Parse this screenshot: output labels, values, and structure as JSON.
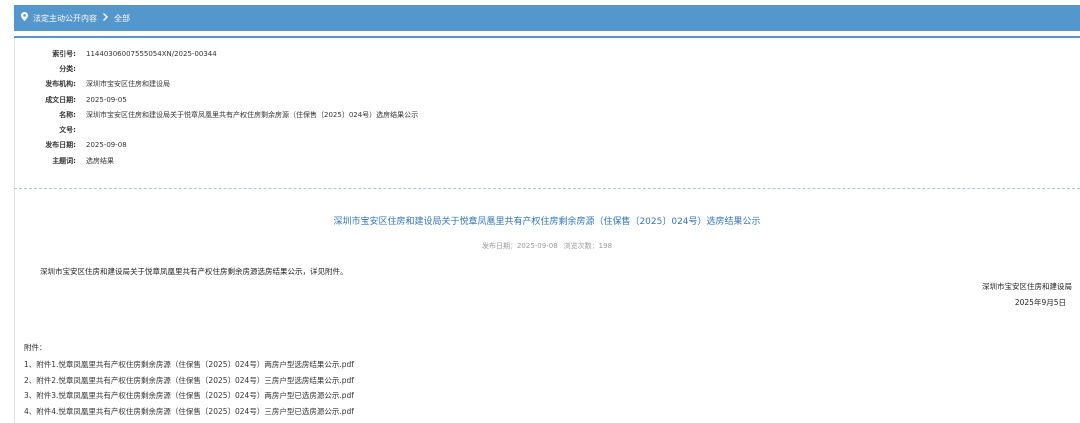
{
  "breadcrumb": {
    "icon": "map-pin-icon",
    "items": [
      "法定主动公开内容",
      "全部"
    ],
    "separator_icon": "chevron-right-icon",
    "bar_color": "#5497cc"
  },
  "meta": {
    "rows": [
      {
        "key": "索引号:",
        "value": "11440306007555054XN/2025-00344"
      },
      {
        "key": "分类:",
        "value": ""
      },
      {
        "key": "发布机构:",
        "value": "深圳市宝安区住房和建设局"
      },
      {
        "key": "成文日期:",
        "value": "2025-09-05"
      },
      {
        "key": "名称:",
        "value": "深圳市宝安区住房和建设局关于悦章凤凰里共有产权住房剩余房源（住保售〔2025〕024号）选房结果公示"
      },
      {
        "key": "文号:",
        "value": ""
      },
      {
        "key": "发布日期:",
        "value": "2025-09-08"
      },
      {
        "key": "主题词:",
        "value": "选房结果"
      }
    ]
  },
  "article": {
    "title": "深圳市宝安区住房和建设局关于悦章凤凰里共有产权住房剩余房源（住保售〔2025〕024号）选房结果公示",
    "publish_label": "发布日期：2025-09-08",
    "views_label": "浏览次数：198",
    "title_color": "#3275b8",
    "body": "深圳市宝安区住房和建设局关于悦章凤凰里共有产权住房剩余房源选房结果公示，详见附件。",
    "sign_org": "深圳市宝安区住房和建设局",
    "sign_date": "2025年9月5日"
  },
  "attachments": {
    "heading": "附件：",
    "items": [
      "1、附件1.悦章凤凰里共有产权住房剩余房源（住保售〔2025〕024号）两房户型选房结果公示.pdf",
      "2、附件2.悦章凤凰里共有产权住房剩余房源（住保售〔2025〕024号）三房户型选房结果公示.pdf",
      "3、附件3.悦章凤凰里共有产权住房剩余房源（住保售〔2025〕024号）两房户型已选房源公示.pdf",
      "4、附件4.悦章凤凰里共有产权住房剩余房源（住保售〔2025〕024号）三房户型已选房源公示.pdf"
    ]
  }
}
